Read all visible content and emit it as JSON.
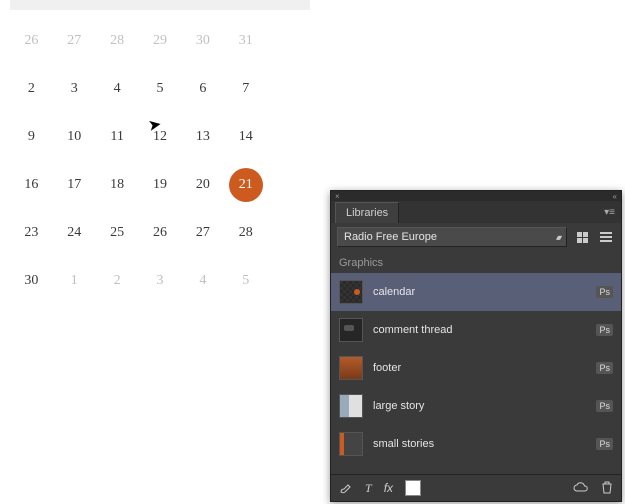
{
  "calendar": {
    "selected": 21,
    "grid": [
      [
        {
          "n": 26,
          "m": true
        },
        {
          "n": 27,
          "m": true
        },
        {
          "n": 28,
          "m": true
        },
        {
          "n": 29,
          "m": true
        },
        {
          "n": 30,
          "m": true
        },
        {
          "n": 31,
          "m": true
        },
        null
      ],
      [
        {
          "n": 2
        },
        {
          "n": 3
        },
        {
          "n": 4
        },
        {
          "n": 5
        },
        {
          "n": 6
        },
        {
          "n": 7
        },
        null
      ],
      [
        {
          "n": 9
        },
        {
          "n": 10
        },
        {
          "n": 11
        },
        {
          "n": 12
        },
        {
          "n": 13
        },
        {
          "n": 14
        },
        null
      ],
      [
        {
          "n": 16
        },
        {
          "n": 17
        },
        {
          "n": 18
        },
        {
          "n": 19
        },
        {
          "n": 20
        },
        {
          "n": 21,
          "sel": true
        },
        null
      ],
      [
        {
          "n": 23
        },
        {
          "n": 24
        },
        {
          "n": 25
        },
        {
          "n": 26
        },
        {
          "n": 27
        },
        {
          "n": 28
        },
        null
      ],
      [
        {
          "n": 30
        },
        {
          "n": 1,
          "m": true
        },
        {
          "n": 2,
          "m": true
        },
        {
          "n": 3,
          "m": true
        },
        {
          "n": 4,
          "m": true
        },
        {
          "n": 5,
          "m": true
        },
        null
      ]
    ],
    "accent_color": "#cd5a1e"
  },
  "panel": {
    "tab_label": "Libraries",
    "dropdown_value": "Radio Free Europe",
    "section_label": "Graphics",
    "assets": [
      {
        "name": "calendar",
        "badge": "Ps",
        "thumb": "cal",
        "selected": true
      },
      {
        "name": "comment thread",
        "badge": "Ps",
        "thumb": "comment",
        "selected": false
      },
      {
        "name": "footer",
        "badge": "Ps",
        "thumb": "footer",
        "selected": false
      },
      {
        "name": "large story",
        "badge": "Ps",
        "thumb": "large",
        "selected": false
      },
      {
        "name": "small stories",
        "badge": "Ps",
        "thumb": "small",
        "selected": false
      }
    ],
    "footer_icons": {
      "brush": "brush-icon",
      "text": "T",
      "fx": "fx",
      "swatch": "swatch",
      "cloud": "cloud-icon",
      "trash": "trash-icon"
    }
  }
}
